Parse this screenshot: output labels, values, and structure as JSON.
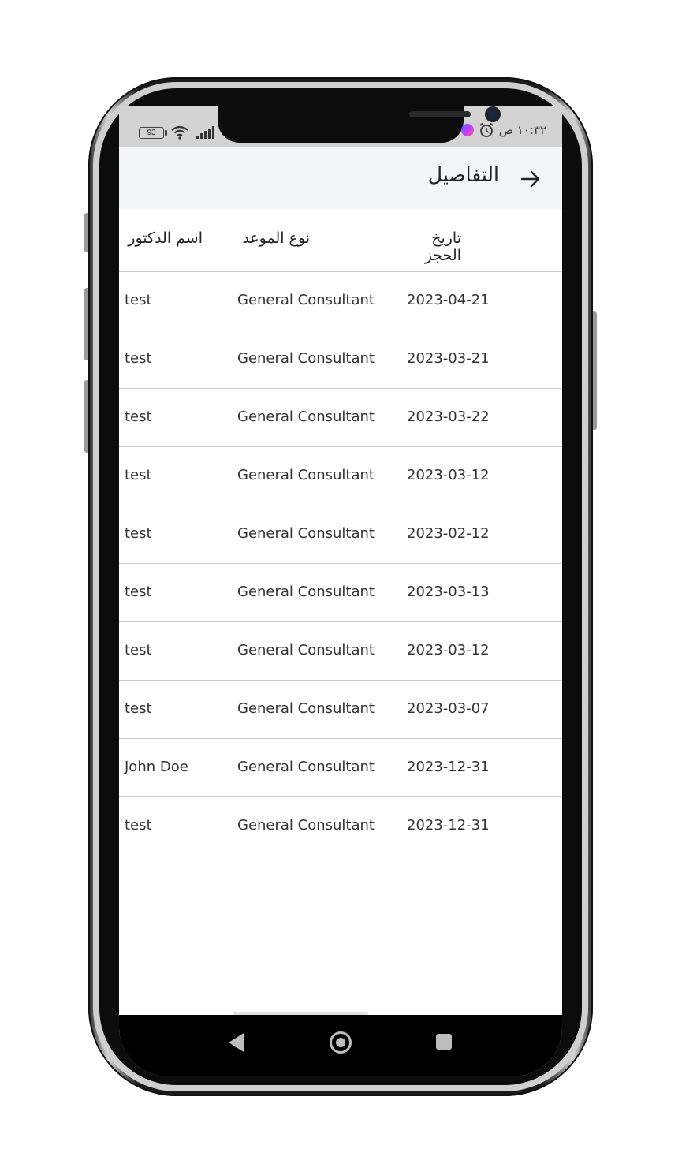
{
  "status_bar": {
    "battery": "93",
    "time": "١٠:٣٢ ص",
    "icons": [
      "battery-icon",
      "wifi-icon",
      "signal-icon",
      "messenger-icon",
      "alarm-icon"
    ]
  },
  "appbar": {
    "title": "التفاصيل",
    "back_icon": "arrow-right-icon"
  },
  "table": {
    "headers": {
      "doctor_name": "اسم الدكتور",
      "appointment_type": "نوع الموعد",
      "booking_date": "تاريخ الحجز"
    },
    "rows": [
      {
        "doctor": "test",
        "type": "General Consultant",
        "date": "2023-04-21"
      },
      {
        "doctor": "test",
        "type": "General Consultant",
        "date": "2023-03-21"
      },
      {
        "doctor": "test",
        "type": "General Consultant",
        "date": "2023-03-22"
      },
      {
        "doctor": "test",
        "type": "General Consultant",
        "date": "2023-03-12"
      },
      {
        "doctor": "test",
        "type": "General Consultant",
        "date": "2023-02-12"
      },
      {
        "doctor": "test",
        "type": "General Consultant",
        "date": "2023-03-13"
      },
      {
        "doctor": "test",
        "type": "General Consultant",
        "date": "2023-03-12"
      },
      {
        "doctor": "test",
        "type": "General Consultant",
        "date": "2023-03-07"
      },
      {
        "doctor": "John Doe",
        "type": "General Consultant",
        "date": "2023-12-31"
      },
      {
        "doctor": "test",
        "type": "General Consultant",
        "date": "2023-12-31"
      }
    ]
  },
  "nav": {
    "back": "nav-back-icon",
    "home": "nav-home-icon",
    "recents": "nav-recents-icon"
  }
}
